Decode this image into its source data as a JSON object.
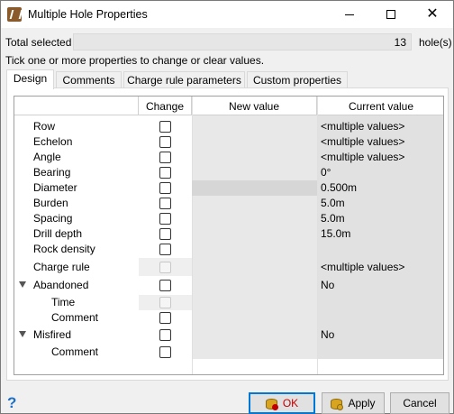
{
  "window": {
    "title": "Multiple Hole Properties",
    "minimize_glyph": "",
    "maximize_glyph": "",
    "close_glyph": "✕"
  },
  "summary": {
    "total_label": "Total selected",
    "total_value": "13",
    "unit": "hole(s)",
    "hint": "Tick one or more properties to change or clear values."
  },
  "tabs": [
    {
      "label": "Design",
      "active": true
    },
    {
      "label": "Comments",
      "active": false
    },
    {
      "label": "Charge rule parameters",
      "active": false
    },
    {
      "label": "Custom properties",
      "active": false
    }
  ],
  "grid": {
    "headers": {
      "change": "Change",
      "new_value": "New value",
      "current_value": "Current value"
    },
    "rows": [
      {
        "label": "Row",
        "current": "<multiple values>"
      },
      {
        "label": "Echelon",
        "current": "<multiple values>"
      },
      {
        "label": "Angle",
        "current": "<multiple values>"
      },
      {
        "label": "Bearing",
        "current": "0°"
      },
      {
        "label": "Diameter",
        "current": "0.500m"
      },
      {
        "label": "Burden",
        "current": "5.0m"
      },
      {
        "label": "Spacing",
        "current": "5.0m"
      },
      {
        "label": "Drill depth",
        "current": "15.0m"
      },
      {
        "label": "Rock density",
        "current": ""
      },
      {
        "label": "Charge rule",
        "current": "<multiple values>"
      },
      {
        "label": "Abandoned",
        "current": "No"
      },
      {
        "label": "Time",
        "current": ""
      },
      {
        "label": "Comment",
        "current": ""
      },
      {
        "label": "Misfired",
        "current": "No"
      },
      {
        "label": "Comment",
        "current": ""
      }
    ]
  },
  "buttons": {
    "ok": "OK",
    "apply": "Apply",
    "cancel": "Cancel"
  },
  "help_glyph": "?",
  "colors": {
    "accent": "#0078d7",
    "ok_text": "#c00000",
    "help": "#1e6fc8"
  }
}
